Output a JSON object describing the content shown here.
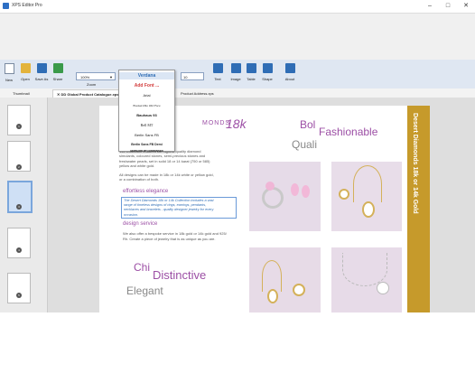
{
  "app": {
    "title": "XPS Editor Pro"
  },
  "ribbon": {
    "new": "New",
    "open": "Open",
    "save_as": "Save As",
    "share": "Share",
    "zoom_value": "100%",
    "zoom_label": "Zoom",
    "font_size": "10",
    "text": "Text",
    "image": "Image",
    "table": "Table",
    "shape": "Shape",
    "about": "About"
  },
  "font_dropdown": {
    "items": [
      "Verdana",
      "Add Font ...",
      "Arial",
      "Bookerville Old Face",
      "Bauhaus 93",
      "Bell MT",
      "Berlin Sans FB",
      "Berlin Sans FB Demi",
      "BERNARD MT CONDENSED"
    ]
  },
  "tabs": {
    "thumbnail": "Thumbnail",
    "doc1": "DD Global Product Catalogue.xps",
    "doc2": "Product Address.xps"
  },
  "thumbnails": {
    "pages": [
      "1",
      "2",
      "3",
      "4",
      "5"
    ]
  },
  "page": {
    "diamonds": "MONDS",
    "diamonds_18k": "18k",
    "bol": "Bol",
    "fashionable": "Fashionable",
    "quali": "Quali",
    "intro": [
      "e Desert Diamonds 18k or",
      "14k Collection features the highest quality diamond",
      "simulants, coloured stones, semi-precious stones and",
      "freshwater pearls, set in solid 18 or 14 karat (750 or 585)",
      "yellow and white gold.",
      "",
      "All designs can be made in 18k or 14k white or yellow gold,",
      "or a combination of both."
    ],
    "elegance_heading": "effortless elegance",
    "elegance_body": [
      "The Desert Diamonds 18k or 14k Collection includes a vast",
      "range of timeless designs of rings, earrings, pendants,",
      "necklaces and bracelets - quality designer jewelry for every",
      "occasion."
    ],
    "design_heading": "design service",
    "design_body": [
      "We also offer a bespoke service in 18k gold or 14k gold and 925/",
      "Rh.  Create a piece of jewelry that is as unique as you are."
    ],
    "chi": "Chi",
    "distinctive": "Distinctive",
    "elegant": "Elegant",
    "side_banner": "Desert Diamonds 18k or 14k Gold"
  },
  "colors": {
    "purple": "#9c4fa5",
    "gold": "#c69a2b",
    "blue": "#2f6db5"
  },
  "icons": [
    "new-icon",
    "open-icon",
    "save-as-icon",
    "share-icon",
    "text-icon",
    "image-icon",
    "table-icon",
    "shape-icon",
    "about-icon"
  ]
}
